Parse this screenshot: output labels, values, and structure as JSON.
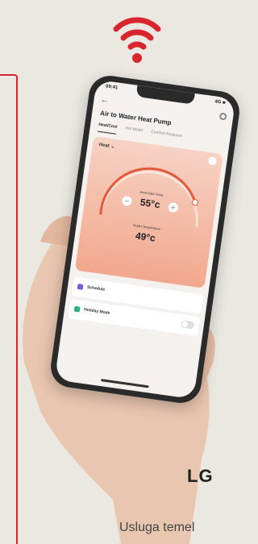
{
  "icons": {
    "wifi": "wifi-icon",
    "back": "back-arrow-icon",
    "settings": "gear-icon",
    "power": "power-icon"
  },
  "colors": {
    "accent": "#d8262e",
    "card_top": "#f7d2c4",
    "card_bottom": "#f1a88d",
    "dial_arc": "#e4593a",
    "background": "#ebe8e2"
  },
  "phone": {
    "status": {
      "time": "09:41",
      "battery": "4G ■"
    },
    "app_title": "Air to Water Heat Pump",
    "tabs": [
      {
        "label": "Heat/Cool",
        "active": true
      },
      {
        "label": "Hot Water",
        "active": false
      },
      {
        "label": "Comfort Features",
        "active": false
      }
    ],
    "control": {
      "mode_label": "Heat ⌄",
      "set_label": "Heat Gate Temp",
      "set_value": "55°c",
      "minus": "−",
      "plus": "+",
      "outdoor_label": "Outlet Temperature",
      "outdoor_value": "49°c"
    },
    "list": [
      {
        "label": "Schedule",
        "color": "#7a5bd6",
        "toggle": false
      },
      {
        "label": "Holiday Mode",
        "color": "#2bb07a",
        "toggle": true
      }
    ]
  },
  "brand": "LG",
  "caption": "Usluga temel"
}
